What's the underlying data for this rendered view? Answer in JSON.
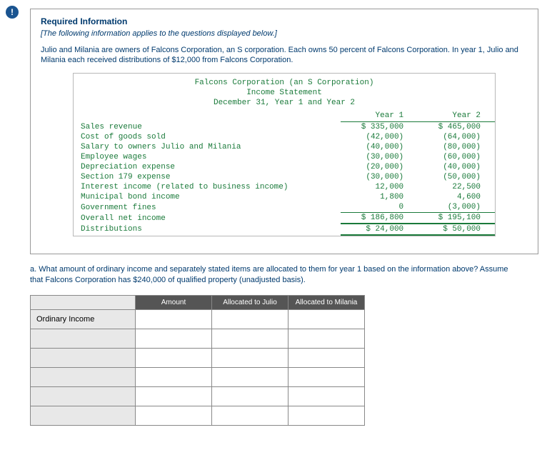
{
  "alertIcon": "!",
  "heading": "Required Information",
  "note": "[The following information applies to the questions displayed below.]",
  "narrative": "Julio and Milania are owners of Falcons Corporation, an S corporation. Each owns 50 percent of Falcons Corporation. In year 1, Julio and Milania each received distributions of $12,000 from Falcons Corporation.",
  "stmt": {
    "title1": "Falcons Corporation (an S Corporation)",
    "title2": "Income Statement",
    "title3": "December 31, Year 1 and Year 2",
    "colHdr1": "Year 1",
    "colHdr2": "Year 2",
    "rows": [
      {
        "label": "Sales revenue",
        "y1": "$ 335,000",
        "y2": "$ 465,000"
      },
      {
        "label": "Cost of goods sold",
        "y1": "(42,000)",
        "y2": "(64,000)"
      },
      {
        "label": "Salary to owners Julio and Milania",
        "y1": "(40,000)",
        "y2": "(80,000)"
      },
      {
        "label": "Employee wages",
        "y1": "(30,000)",
        "y2": "(60,000)"
      },
      {
        "label": "Depreciation expense",
        "y1": "(20,000)",
        "y2": "(40,000)"
      },
      {
        "label": "Section 179 expense",
        "y1": "(30,000)",
        "y2": "(50,000)"
      },
      {
        "label": "Interest income (related to business income)",
        "y1": "12,000",
        "y2": "22,500"
      },
      {
        "label": "Municipal bond income",
        "y1": "1,800",
        "y2": "4,600"
      },
      {
        "label": "Government fines",
        "y1": "0",
        "y2": "(3,000)"
      }
    ],
    "netLbl": "Overall net income",
    "netY1": "$ 186,800",
    "netY2": "$ 195,100",
    "distLbl": "Distributions",
    "distY1": "$ 24,000",
    "distY2": "$ 50,000"
  },
  "question": "a. What amount of ordinary income and separately stated items are allocated to them for year 1 based on the information above? Assume that Falcons Corporation has $240,000 of qualified property (unadjusted basis).",
  "ans": {
    "h1": "Amount",
    "h2": "Allocated to Julio",
    "h3": "Allocated to Milania",
    "r1": "Ordinary Income"
  }
}
